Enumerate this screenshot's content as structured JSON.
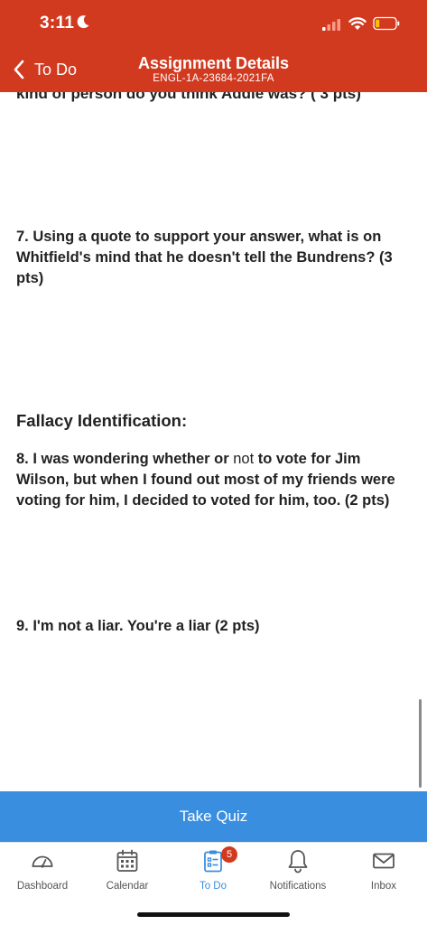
{
  "status_bar": {
    "time": "3:11",
    "colors": {
      "signal_active": "#ffffff",
      "signal_inactive": "#ff9a88",
      "battery_fill": "#ffc300"
    }
  },
  "nav": {
    "back_label": "To Do",
    "title": "Assignment Details",
    "subtitle": "ENGL-1A-23684-2021FA",
    "icons": {
      "back": "chevron-left-icon"
    }
  },
  "content": {
    "cut_off_line": "kind of person do you think Addie was? ( 3 pts)",
    "q7": "7.  Using a quote to support your answer, what is on Whitfield's mind that he doesn't tell the Bundrens? (3 pts)",
    "section_heading": "Fallacy Identification:",
    "q8": {
      "before": "8.  I was wondering whether or ",
      "not": "not",
      "after": " to vote for Jim Wilson, but when I found out most of my friends were voting for him, I decided to voted for him, too. (2 pts)"
    },
    "q9": "9.  I'm not a liar.  You're a liar (2 pts)"
  },
  "take_quiz_label": "Take Quiz",
  "tabbar": {
    "tabs": [
      {
        "label": "Dashboard",
        "icon": "dashboard-icon"
      },
      {
        "label": "Calendar",
        "icon": "calendar-icon"
      },
      {
        "label": "To Do",
        "icon": "todo-icon",
        "badge": "5"
      },
      {
        "label": "Notifications",
        "icon": "bell-icon"
      },
      {
        "label": "Inbox",
        "icon": "envelope-icon"
      }
    ]
  },
  "colors": {
    "header": "#d23a20",
    "accent": "#3a8ee0",
    "badge": "#d23a20"
  }
}
